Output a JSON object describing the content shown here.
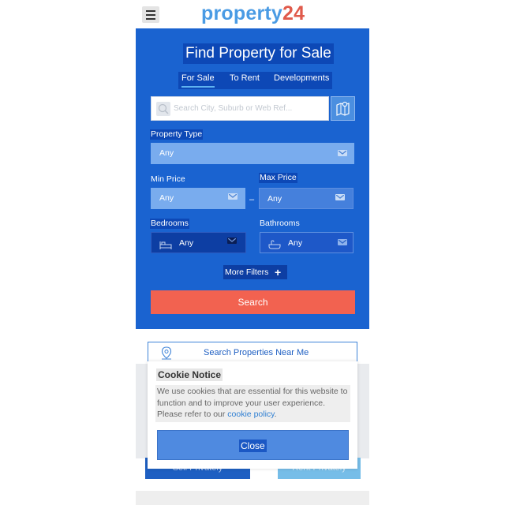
{
  "header": {
    "logo_part1": "property",
    "logo_part2": "24"
  },
  "search": {
    "title": "Find Property for Sale",
    "tabs": [
      {
        "label": "For Sale",
        "active": true
      },
      {
        "label": "To Rent",
        "active": false
      },
      {
        "label": "Developments",
        "active": false
      }
    ],
    "placeholder": "Search City, Suburb or Web Ref...",
    "property_type_label": "Property Type",
    "property_type_value": "Any",
    "min_price_label": "Min Price",
    "min_price_value": "Any",
    "max_price_label": "Max Price",
    "max_price_value": "Any",
    "price_separator": "–",
    "bedrooms_label": "Bedrooms",
    "bedrooms_value": "Any",
    "bathrooms_label": "Bathrooms",
    "bathrooms_value": "Any",
    "more_filters_label": "More Filters",
    "search_button_label": "Search"
  },
  "near_me": {
    "label": "Search Properties Near Me"
  },
  "actions": {
    "sell_label": "Sell Privately",
    "rent_label": "Rent Privately"
  },
  "cookie": {
    "title": "Cookie Notice",
    "body": "We use cookies that are essential for this website to function and to improve your user experience. Please refer to our ",
    "link_text": "cookie policy",
    "body_end": ".",
    "close_label": "Close"
  },
  "colors": {
    "panel_blue": "#1a63d0",
    "accent_red": "#f26250",
    "logo_blue": "#4a9be4",
    "logo_red": "#e05a4b"
  },
  "icons": [
    "menu-icon",
    "search-icon",
    "map-icon",
    "chevron-down-icon",
    "bed-icon",
    "bath-icon",
    "plus-icon",
    "location-pin-icon"
  ]
}
